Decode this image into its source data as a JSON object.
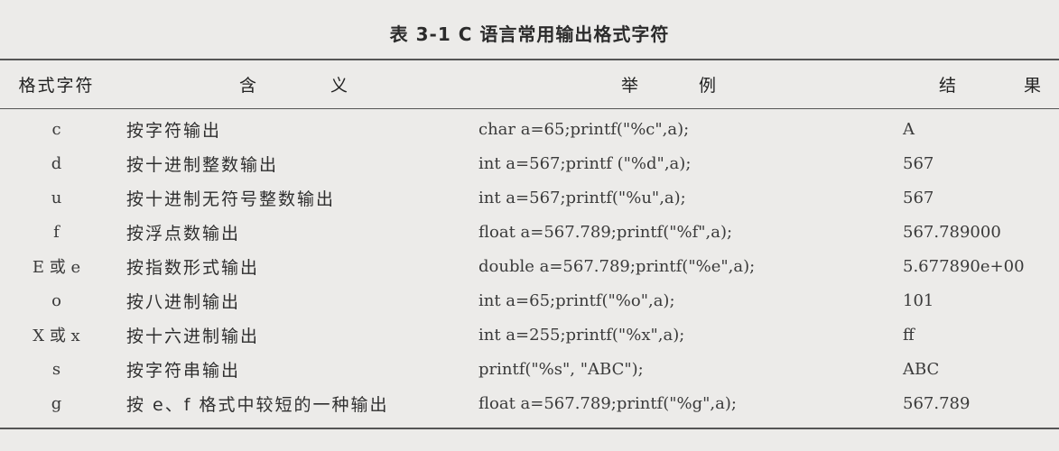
{
  "caption": "表 3-1   C 语言常用输出格式字符",
  "headers": {
    "format": "格式字符",
    "meaning_a": "含",
    "meaning_b": "义",
    "example_a": "举",
    "example_b": "例",
    "result_a": "结",
    "result_b": "果"
  },
  "rows": [
    {
      "format": "c",
      "meaning": "按字符输出",
      "example": "char a=65;printf(\"%c\",a);",
      "result": "A"
    },
    {
      "format": "d",
      "meaning": "按十进制整数输出",
      "example": "int a=567;printf (\"%d\",a);",
      "result": "567"
    },
    {
      "format": "u",
      "meaning": "按十进制无符号整数输出",
      "example": "int a=567;printf(\"%u\",a);",
      "result": "567"
    },
    {
      "format": "f",
      "meaning": "按浮点数输出",
      "example": "float a=567.789;printf(\"%f\",a);",
      "result": "567.789000"
    },
    {
      "format": "E 或 e",
      "meaning": "按指数形式输出",
      "example": "double a=567.789;printf(\"%e\",a);",
      "result": "5.677890e+00"
    },
    {
      "format": "o",
      "meaning": "按八进制输出",
      "example": "int a=65;printf(\"%o\",a);",
      "result": "101"
    },
    {
      "format": "X 或 x",
      "meaning": "按十六进制输出",
      "example": "int a=255;printf(\"%x\",a);",
      "result": "ff"
    },
    {
      "format": "s",
      "meaning": "按字符串输出",
      "example": "printf(\"%s\", \"ABC\");",
      "result": "ABC"
    },
    {
      "format": "g",
      "meaning": "按 e、f 格式中较短的一种输出",
      "example": "float a=567.789;printf(\"%g\",a);",
      "result": "567.789"
    }
  ]
}
